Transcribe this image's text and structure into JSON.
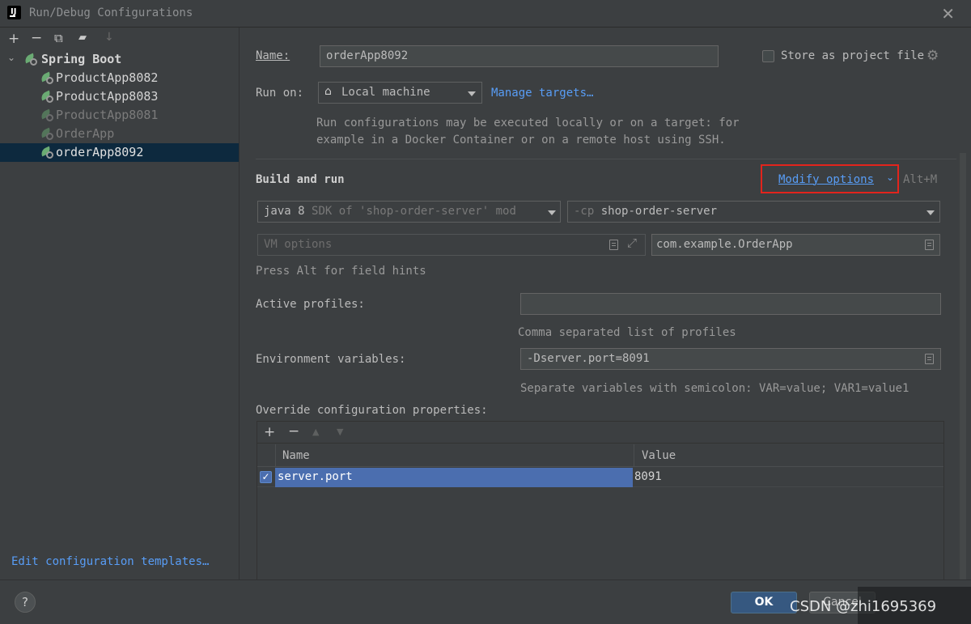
{
  "window": {
    "title": "Run/Debug Configurations",
    "app_icon_glyph": "IJ"
  },
  "left_toolbar": {
    "add": "+",
    "remove": "−",
    "copy": "⧉",
    "folder": "▰",
    "sort": "↓"
  },
  "tree": {
    "group": "Spring Boot",
    "items": [
      {
        "label": "ProductApp8082",
        "dim": false
      },
      {
        "label": "ProductApp8083",
        "dim": false
      },
      {
        "label": "ProductApp8081",
        "dim": true
      },
      {
        "label": "OrderApp",
        "dim": true
      },
      {
        "label": "orderApp8092",
        "dim": false,
        "selected": true
      }
    ]
  },
  "edit_templates_link": "Edit configuration templates…",
  "form": {
    "name_label": "Name:",
    "name_value": "orderApp8092",
    "store_label": "Store as project file",
    "run_on_label": "Run on:",
    "run_on_value": "Local machine",
    "manage_targets": "Manage targets…",
    "run_on_hint_1": "Run configurations may be executed locally or on a target: for",
    "run_on_hint_2": "example in a Docker Container or on a remote host using SSH.",
    "build_and_run": "Build and run",
    "modify_options": "Modify options",
    "modify_shortcut": "Alt+M",
    "jdk_value_main": "java 8",
    "jdk_value_dim": "SDK of 'shop-order-server' mod",
    "cp_prefix": "-cp",
    "cp_value": "shop-order-server",
    "vm_options_placeholder": "VM options",
    "main_class": "com.example.OrderApp",
    "press_alt_hint": "Press Alt for field hints",
    "active_profiles_label": "Active profiles:",
    "active_profiles_value": "",
    "active_profiles_hint": "Comma separated list of profiles",
    "env_label": "Environment variables:",
    "env_value": "-Dserver.port=8091",
    "env_hint": "Separate variables with semicolon: VAR=value; VAR1=value1",
    "override_label": "Override configuration properties:"
  },
  "override_table": {
    "tools": {
      "add": "+",
      "remove": "−",
      "up": "▲",
      "down": "▼"
    },
    "columns": [
      "Name",
      "Value"
    ],
    "rows": [
      {
        "checked": true,
        "name": "server.port",
        "value": "8091"
      }
    ]
  },
  "buttons": {
    "help": "?",
    "ok": "OK",
    "cancel": "Cancel"
  },
  "watermark": "CSDN @zhi1695369"
}
